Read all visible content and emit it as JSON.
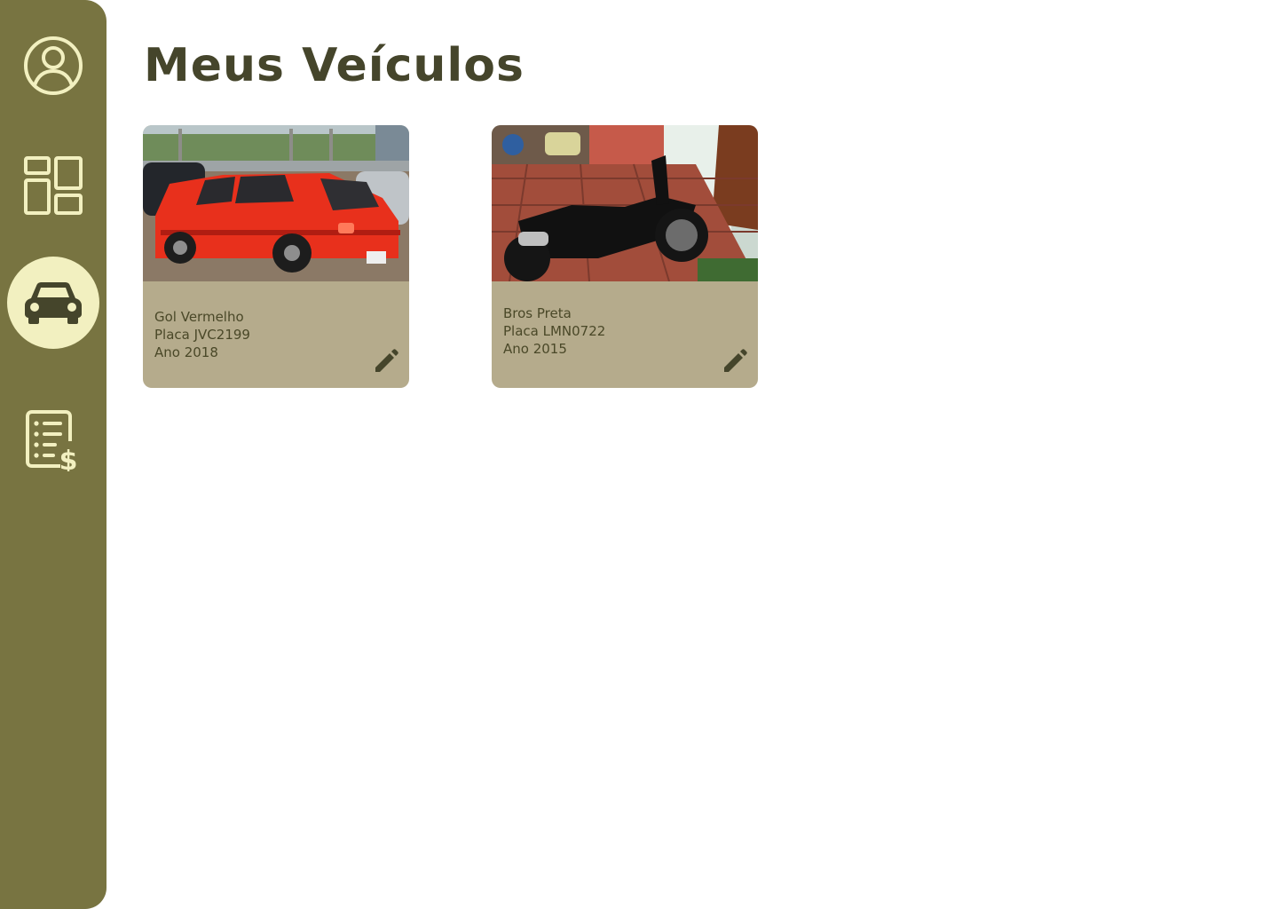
{
  "page": {
    "title": "Meus Veículos"
  },
  "sidebar": {
    "items": [
      {
        "icon": "user-circle-icon",
        "active": false
      },
      {
        "icon": "dashboard-icon",
        "active": false
      },
      {
        "icon": "car-icon",
        "active": true
      },
      {
        "icon": "invoice-icon",
        "active": false
      }
    ]
  },
  "vehicles": [
    {
      "photo": "red-hatchback-photo",
      "name": "Gol Vermelho",
      "plate": "Placa JVC2199",
      "year": "Ano 2018",
      "edit_icon": "pencil-icon"
    },
    {
      "photo": "black-motorcycle-photo",
      "name": "Bros Preta",
      "plate": "Placa LMN0722",
      "year": "Ano 2015",
      "edit_icon": "pencil-icon"
    }
  ],
  "colors": {
    "sidebar": "#787441",
    "active_nav": "#f2f0c0",
    "title": "#45452b",
    "card": "#b5ab8c",
    "card_text": "#4a4828"
  }
}
